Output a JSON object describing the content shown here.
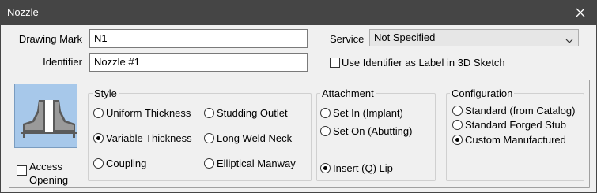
{
  "window": {
    "title": "Nozzle"
  },
  "fields": {
    "drawing_mark_label": "Drawing Mark",
    "drawing_mark_value": "N1",
    "identifier_label": "Identifier",
    "identifier_value": "Nozzle #1",
    "service_label": "Service",
    "service_value": "Not Specified",
    "use_identifier_label": "Use Identifier as Label in 3D Sketch",
    "use_identifier_checked": false
  },
  "access_opening": {
    "label_line1": "Access",
    "label_line2": "Opening",
    "checked": false
  },
  "style": {
    "title": "Style",
    "options": [
      {
        "label": "Uniform Thickness",
        "selected": false
      },
      {
        "label": "Studding Outlet",
        "selected": false
      },
      {
        "label": "Variable Thickness",
        "selected": true
      },
      {
        "label": "Long Weld Neck",
        "selected": false
      },
      {
        "label": "Coupling",
        "selected": false
      },
      {
        "label": "Elliptical Manway",
        "selected": false
      }
    ]
  },
  "attachment": {
    "title": "Attachment",
    "options": [
      {
        "label": "Set In (Implant)",
        "selected": false
      },
      {
        "label": "Set On (Abutting)",
        "selected": false
      },
      {
        "label": "Insert (Q) Lip",
        "selected": true
      }
    ]
  },
  "configuration": {
    "title": "Configuration",
    "options": [
      {
        "label": "Standard (from Catalog)",
        "selected": false
      },
      {
        "label": "Standard Forged Stub",
        "selected": false
      },
      {
        "label": "Custom Manufactured",
        "selected": true
      }
    ]
  },
  "colors": {
    "titlebar": "#454545",
    "client": "#f0f0f0",
    "picture_bg": "#a7c8ea"
  },
  "icons": {
    "close": "close-icon",
    "dropdown": "chevron-down-icon",
    "nozzle": "nozzle-cross-section-icon"
  }
}
